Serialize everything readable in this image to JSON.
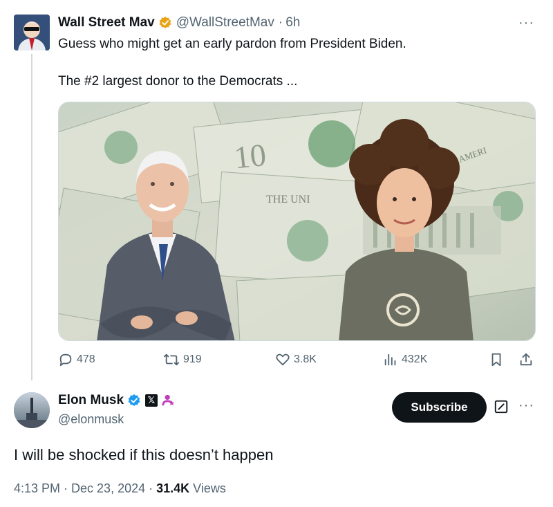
{
  "quoted_post": {
    "author_name": "Wall Street Mav",
    "handle": "@WallStreetMav",
    "separator": "·",
    "time": "6h",
    "more": "···",
    "text_line1": "Guess who might get an early pardon from President Biden.",
    "text_line2": "The #2 largest donor to the Democrats ...",
    "media_description": "photo",
    "actions": {
      "replies": "478",
      "reposts": "919",
      "likes": "3.8K",
      "views": "432K"
    }
  },
  "main_post": {
    "author_name": "Elon Musk",
    "handle": "@elonmusk",
    "subscribe_label": "Subscribe",
    "more": "···",
    "text": "I will be shocked if this doesn’t happen",
    "timestamp": "4:13 PM · Dec 23, 2024 · ",
    "views_count": "31.4K",
    "views_label": " Views",
    "x_badge": "𝕏"
  },
  "colors": {
    "text_primary": "#0f1419",
    "text_secondary": "#536471",
    "verified_gold": "#e8a317",
    "verified_blue": "#1d9bf0",
    "affiliate_purple": "#c23dbd",
    "subscribe_bg": "#0f1419"
  },
  "icons": {
    "reply": "reply-icon",
    "repost": "repost-icon",
    "like": "heart-icon",
    "views": "views-icon",
    "bookmark": "bookmark-icon",
    "share": "share-icon",
    "edit": "edit-icon"
  }
}
